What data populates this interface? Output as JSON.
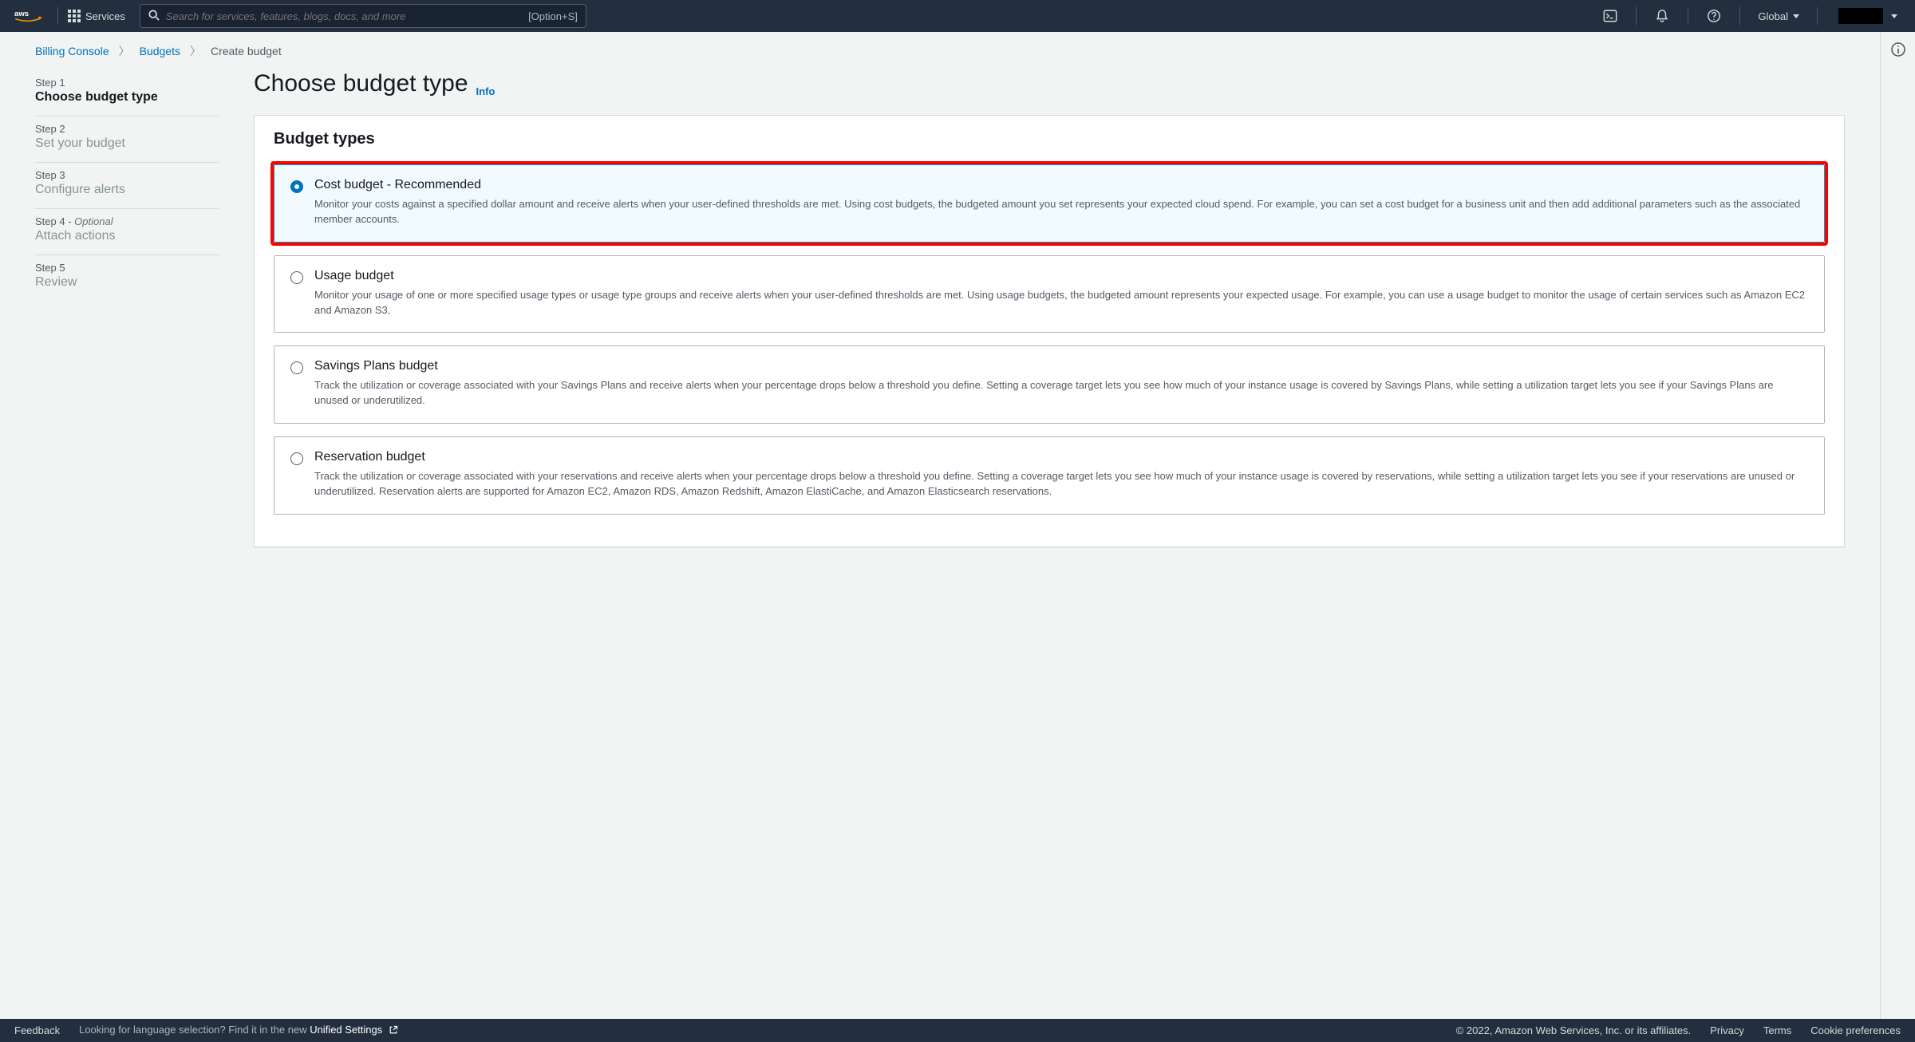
{
  "topnav": {
    "services_label": "Services",
    "search_placeholder": "Search for services, features, blogs, docs, and more",
    "search_hotkey": "[Option+S]",
    "region_label": "Global"
  },
  "breadcrumbs": {
    "billing": "Billing Console",
    "budgets": "Budgets",
    "current": "Create budget"
  },
  "steps": [
    {
      "num": "Step 1",
      "title": "Choose budget type",
      "active": true
    },
    {
      "num": "Step 2",
      "title": "Set your budget",
      "active": false
    },
    {
      "num": "Step 3",
      "title": "Configure alerts",
      "active": false
    },
    {
      "num": "Step 4",
      "optional": "Optional",
      "title": "Attach actions",
      "active": false
    },
    {
      "num": "Step 5",
      "title": "Review",
      "active": false
    }
  ],
  "page": {
    "heading": "Choose budget type",
    "info_link": "Info"
  },
  "card": {
    "header": "Budget types"
  },
  "options": [
    {
      "title": "Cost budget - Recommended",
      "desc": "Monitor your costs against a specified dollar amount and receive alerts when your user-defined thresholds are met. Using cost budgets, the budgeted amount you set represents your expected cloud spend. For example, you can set a cost budget for a business unit and then add additional parameters such as the associated member accounts.",
      "selected": true,
      "highlight": true
    },
    {
      "title": "Usage budget",
      "desc": "Monitor your usage of one or more specified usage types or usage type groups and receive alerts when your user-defined thresholds are met. Using usage budgets, the budgeted amount represents your expected usage. For example, you can use a usage budget to monitor the usage of certain services such as Amazon EC2 and Amazon S3.",
      "selected": false,
      "highlight": false
    },
    {
      "title": "Savings Plans budget",
      "desc": "Track the utilization or coverage associated with your Savings Plans and receive alerts when your percentage drops below a threshold you define. Setting a coverage target lets you see how much of your instance usage is covered by Savings Plans, while setting a utilization target lets you see if your Savings Plans are unused or underutilized.",
      "selected": false,
      "highlight": false
    },
    {
      "title": "Reservation budget",
      "desc": "Track the utilization or coverage associated with your reservations and receive alerts when your percentage drops below a threshold you define. Setting a coverage target lets you see how much of your instance usage is covered by reservations, while setting a utilization target lets you see if your reservations are unused or underutilized. Reservation alerts are supported for Amazon EC2, Amazon RDS, Amazon Redshift, Amazon ElastiCache, and Amazon Elasticsearch reservations.",
      "selected": false,
      "highlight": false
    }
  ],
  "footer": {
    "feedback": "Feedback",
    "lang_prefix": "Looking for language selection? Find it in the new ",
    "lang_link": "Unified Settings",
    "copyright": "© 2022, Amazon Web Services, Inc. or its affiliates.",
    "privacy": "Privacy",
    "terms": "Terms",
    "cookies": "Cookie preferences"
  }
}
